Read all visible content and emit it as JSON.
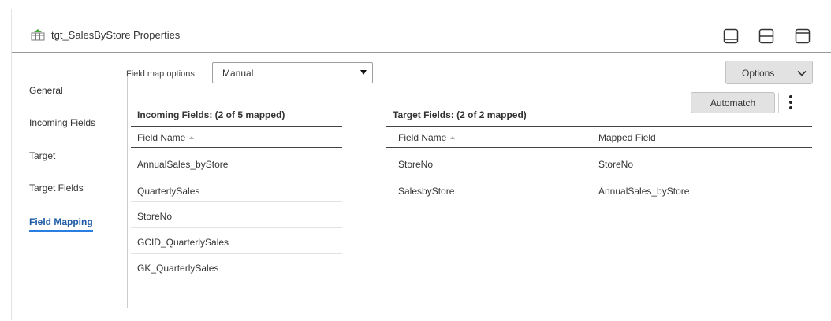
{
  "panel": {
    "title": "tgt_SalesByStore Properties",
    "title_icon": "target-table-icon",
    "layout_buttons": [
      "layout-bottom-icon",
      "layout-split-icon",
      "layout-top-icon"
    ]
  },
  "nav": {
    "items": [
      {
        "label": "General",
        "active": false
      },
      {
        "label": "Incoming Fields",
        "active": false
      },
      {
        "label": "Target",
        "active": false
      },
      {
        "label": "Target Fields",
        "active": false
      },
      {
        "label": "Field Mapping",
        "active": true
      }
    ],
    "active_color": "#1d5aa6",
    "underline_color": "#2a7de1"
  },
  "field_map": {
    "label": "Field map options:",
    "selected": "Manual"
  },
  "options_button": {
    "label": "Options",
    "icon": "chevron-down-icon"
  },
  "incoming": {
    "title": "Incoming Fields: (2 of 5 mapped)",
    "column": "Field Name",
    "rows": [
      "AnnualSales_byStore",
      "QuarterlySales",
      "StoreNo",
      "GCID_QuarterlySales",
      "GK_QuarterlySales"
    ]
  },
  "target": {
    "title": "Target Fields: (2 of 2 mapped)",
    "columns": [
      "Field Name",
      "Mapped Field"
    ],
    "rows": [
      {
        "field": "StoreNo",
        "mapped": "StoreNo"
      },
      {
        "field": "SalesbyStore",
        "mapped": "AnnualSales_byStore"
      }
    ]
  },
  "automatch_button": {
    "label": "Automatch"
  },
  "more_menu": {
    "icon": "kebab-menu-icon"
  }
}
